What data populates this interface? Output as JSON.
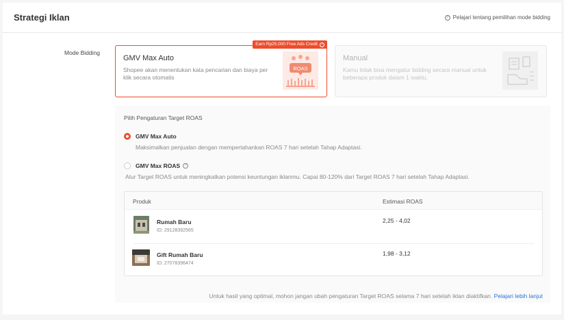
{
  "header": {
    "title": "Strategi Iklan",
    "help_text": "Pelajari tentang pemilihan mode bidding"
  },
  "mode_bidding": {
    "label": "Mode Bidding",
    "options": [
      {
        "title": "GMV Max Auto",
        "description": "Shopee akan menentukan kata pencarian dan biaya per klik secara otomatis",
        "badge": "Earn Rp25.000 Free Ads Credit",
        "selected": true,
        "illustration_text": "ROAS"
      },
      {
        "title": "Manual",
        "description": "Kamu tidak bisa mengatur bidding secara manual untuk beberapa produk dalam 1 waktu.",
        "selected": false
      }
    ]
  },
  "target_roas": {
    "title": "Pilih Pengaturan Target ROAS",
    "options": [
      {
        "label": "GMV Max Auto",
        "description": "Maksimalkan penjualan dengan mempertahankan ROAS 7 hari setelah Tahap Adaptasi.",
        "selected": true
      },
      {
        "label": "GMV Max ROAS",
        "description": "Atur Target ROAS untuk meningkatkan potensi keuntungan iklanmu. Capai 80-120% dari Target ROAS 7 hari setelah Tahap Adaptasi.",
        "selected": false
      }
    ]
  },
  "table": {
    "columns": [
      "Produk",
      "Estimasi ROAS"
    ],
    "rows": [
      {
        "name": "Rumah Baru",
        "id": "ID: 29128392565",
        "estimate": "2,25 - 4,02"
      },
      {
        "name": "Gift Rumah Baru",
        "id": "ID: 27078396474",
        "estimate": "1,98 - 3,12"
      }
    ]
  },
  "footer": {
    "text": "Untuk hasil yang optimal, mohon jangan ubah pengaturan Target ROAS selama 7 hari setelah iklan diaktifkan.",
    "link": "Pelajari lebih lanjut"
  },
  "colors": {
    "accent": "#ee4d2d",
    "link": "#2673dd"
  }
}
